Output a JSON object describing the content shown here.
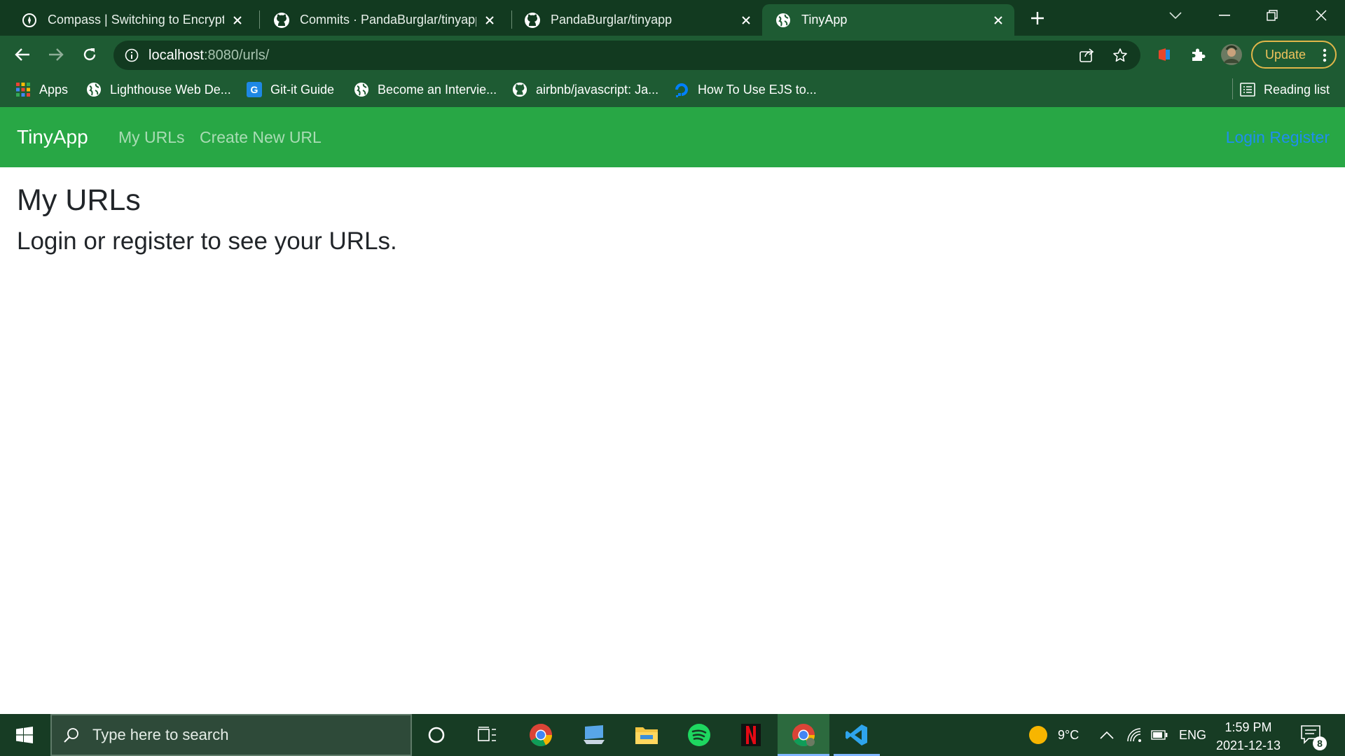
{
  "browser": {
    "tabs": [
      {
        "title": "Compass | Switching to Encrypted",
        "icon": "compass-icon",
        "active": false
      },
      {
        "title": "Commits · PandaBurglar/tinyapp",
        "icon": "github-icon",
        "active": false
      },
      {
        "title": "PandaBurglar/tinyapp",
        "icon": "github-icon",
        "active": false
      },
      {
        "title": "TinyApp",
        "icon": "globe-icon",
        "active": true
      }
    ],
    "url_host": "localhost",
    "url_rest": ":8080/urls/",
    "update_label": "Update",
    "bookmarks": [
      {
        "label": "Apps",
        "icon": "apps-grid-icon"
      },
      {
        "label": "Lighthouse Web De...",
        "icon": "globe-icon"
      },
      {
        "label": "Git-it Guide",
        "icon": "git-it-icon"
      },
      {
        "label": "Become an Intervie...",
        "icon": "globe-icon"
      },
      {
        "label": "airbnb/javascript: Ja...",
        "icon": "github-icon"
      },
      {
        "label": "How To Use EJS to...",
        "icon": "digitalocean-icon"
      }
    ],
    "reading_list": "Reading list"
  },
  "navbar": {
    "brand": "TinyApp",
    "links": [
      "My URLs",
      "Create New URL"
    ],
    "auth": "Login Register"
  },
  "page": {
    "heading": "My URLs",
    "message": "Login or register to see your URLs."
  },
  "taskbar": {
    "search_placeholder": "Type here to search",
    "weather": "9°C",
    "language": "ENG",
    "time": "1:59 PM",
    "date": "2021-12-13",
    "notification_count": "8"
  },
  "colors": {
    "tab_strip": "#123a20",
    "toolbar": "#1e5b33",
    "navbar": "#28a745",
    "auth_link": "#1f8ef0",
    "taskbar": "#173c24"
  }
}
